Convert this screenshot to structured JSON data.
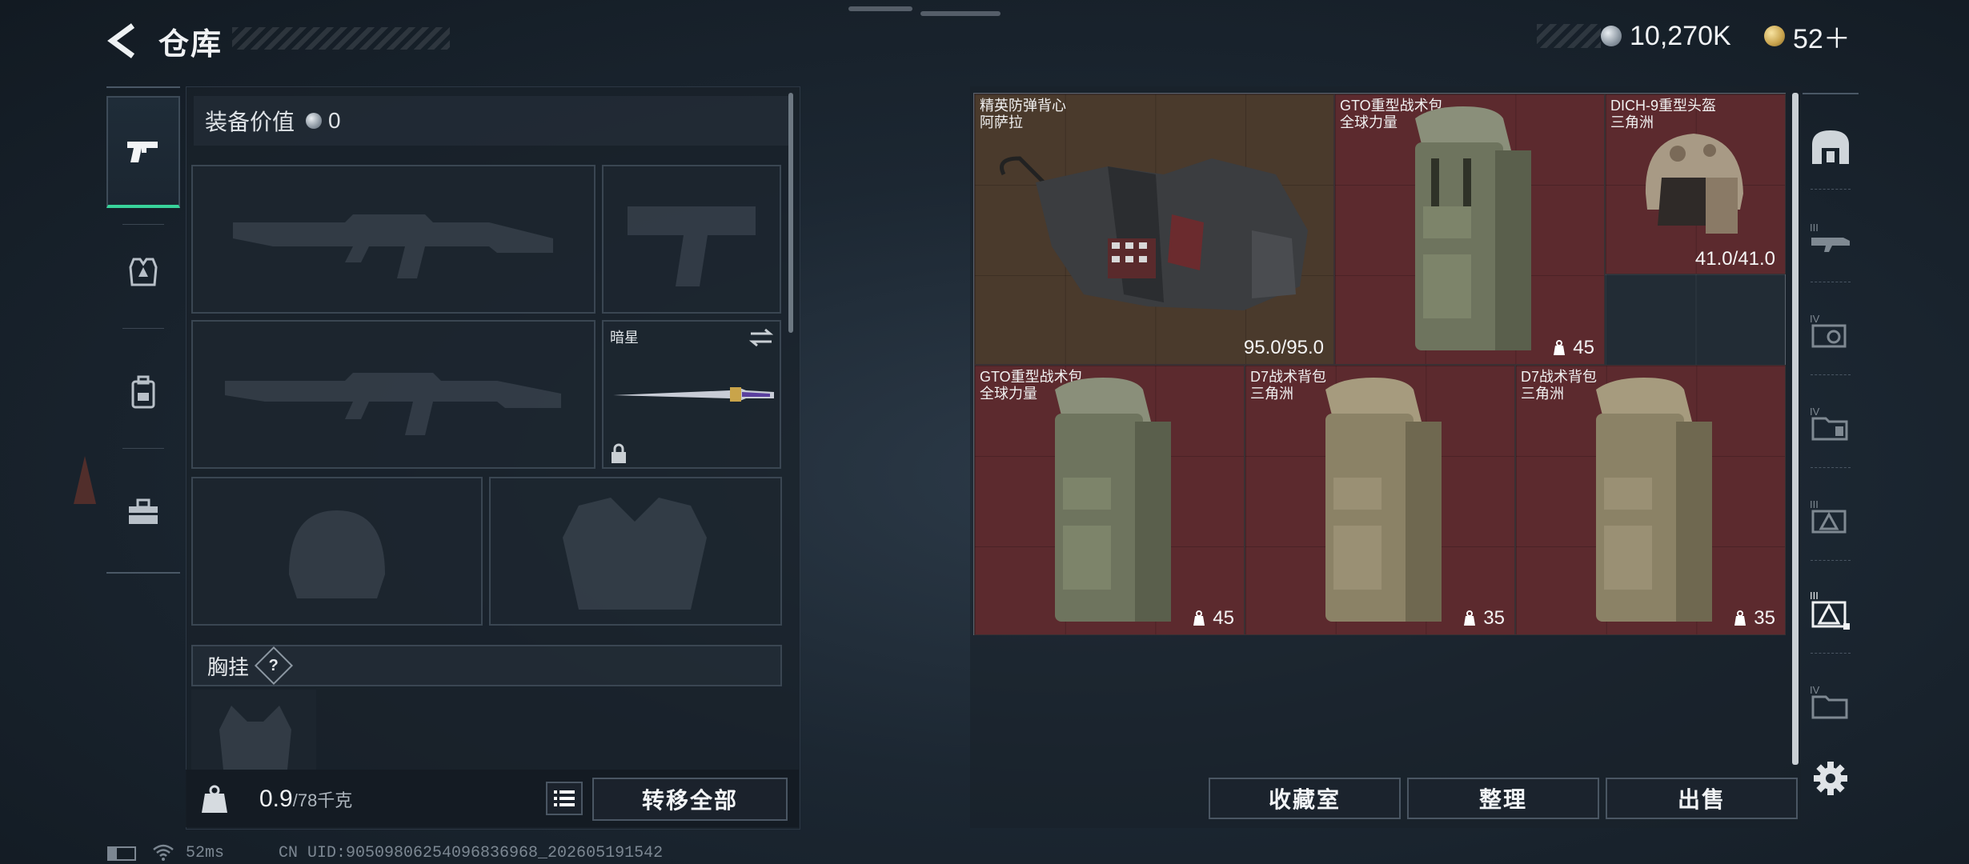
{
  "header": {
    "title": "仓库",
    "silver_amount": "10,270K",
    "gold_amount": "52＋"
  },
  "left_rail": {
    "items": [
      {
        "name": "weapons",
        "icon": "pistol-icon",
        "active": true
      },
      {
        "name": "armor",
        "icon": "vest-icon",
        "active": false
      },
      {
        "name": "backpack",
        "icon": "backpack-icon",
        "active": false
      },
      {
        "name": "medkit",
        "icon": "toolbox-icon",
        "active": false
      }
    ]
  },
  "loadout": {
    "value_label": "装备价值",
    "value_amount": "0",
    "melee_name": "暗星",
    "chest_label": "胸挂",
    "help_label": "?",
    "weight_value": "0.9",
    "weight_max": "/78千克",
    "transfer_all_label": "转移全部"
  },
  "stash": {
    "items": [
      {
        "name_line1": "精英防弹背心",
        "name_line2": "阿萨拉",
        "value": "95.0/95.0",
        "bg": "brown",
        "icon": "armor-vest-image"
      },
      {
        "name_line1": "GTO重型战术包",
        "name_line2": "全球力量",
        "value": "45",
        "bg": "red",
        "icon": "backpack-image"
      },
      {
        "name_line1": "DICH-9重型头盔",
        "name_line2": "三角洲",
        "value": "41.0/41.0",
        "bg": "red",
        "icon": "helmet-image"
      },
      {
        "name_line1": "GTO重型战术包",
        "name_line2": "全球力量",
        "value": "45",
        "bg": "red",
        "icon": "backpack-image"
      },
      {
        "name_line1": "D7战术背包",
        "name_line2": "三角洲",
        "value": "35",
        "bg": "red",
        "icon": "backpack-image"
      },
      {
        "name_line1": "D7战术背包",
        "name_line2": "三角洲",
        "value": "35",
        "bg": "red",
        "icon": "backpack-image"
      }
    ],
    "buttons": {
      "collection": "收藏室",
      "sort": "整理",
      "sell": "出售"
    }
  },
  "side_tabs": [
    {
      "icon": "stash-home-icon"
    },
    {
      "icon": "tier-iii-rifle-icon"
    },
    {
      "icon": "tier-iv-gear-icon"
    },
    {
      "icon": "tier-iv-folder-icon"
    },
    {
      "icon": "tier-iii-warning-icon"
    },
    {
      "icon": "tier-iii-warning-active-icon"
    },
    {
      "icon": "tier-iv-folder-2-icon"
    },
    {
      "icon": "settings-icon"
    }
  ],
  "status": {
    "ping": "52ms",
    "uid": "CN UID:90509806254096836968_202605191542"
  },
  "colors": {
    "accent_green": "#38d39a",
    "item_red": "#5c2a2e",
    "item_brown": "#4a3a2c"
  }
}
